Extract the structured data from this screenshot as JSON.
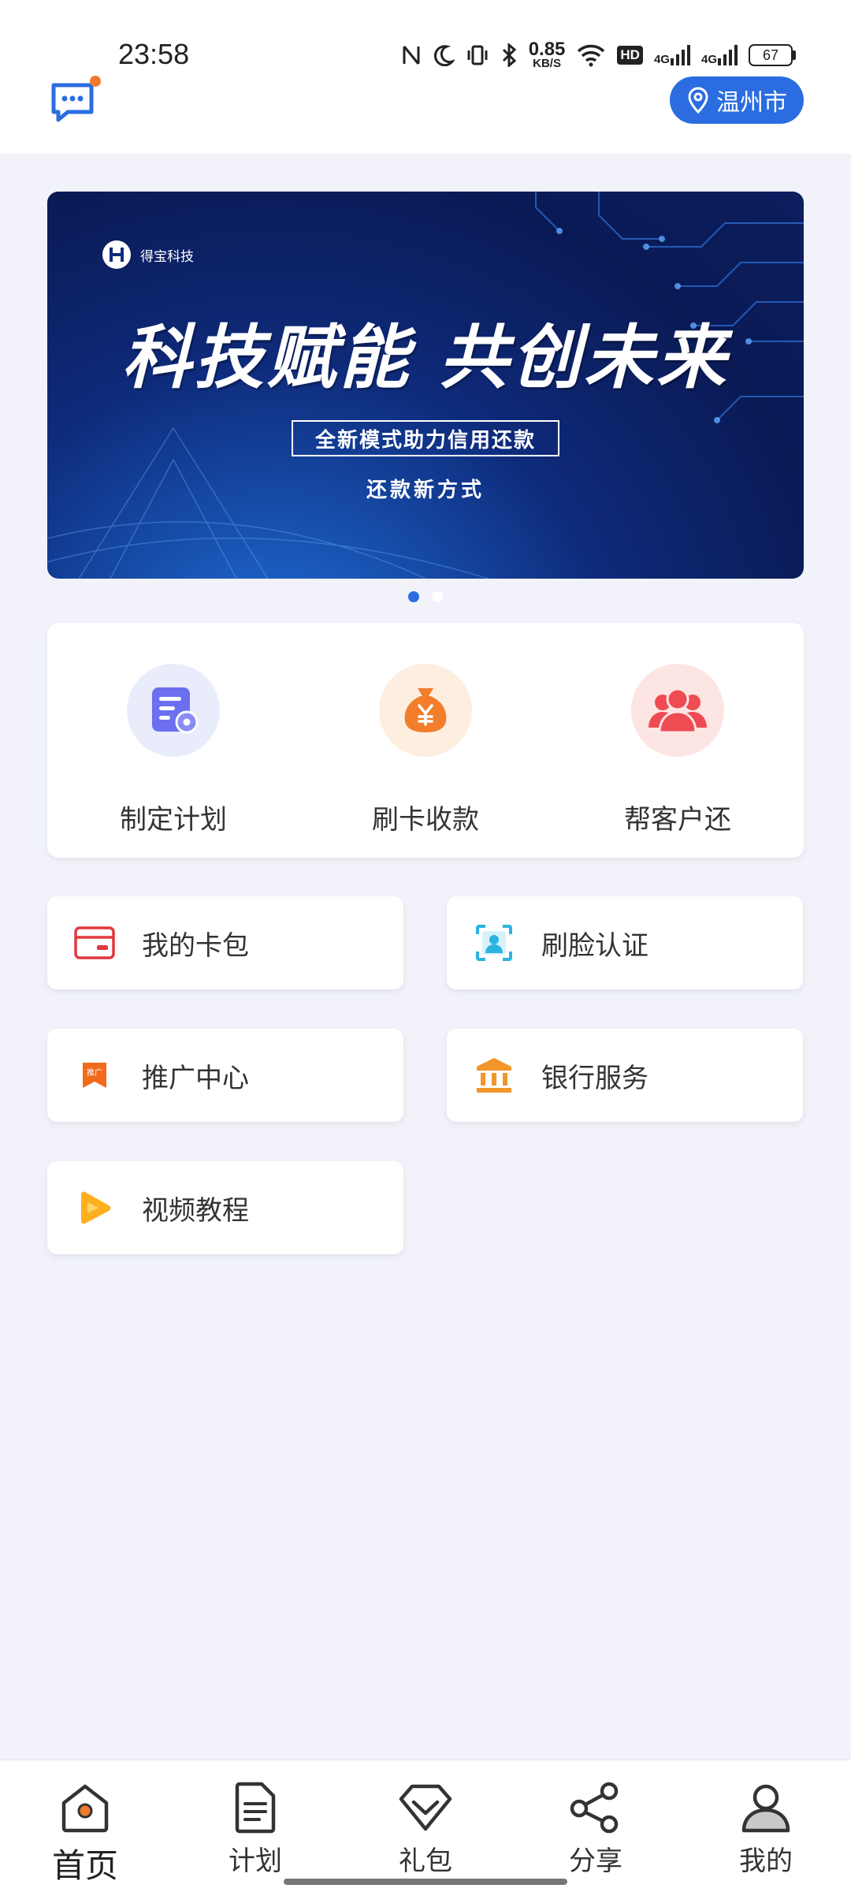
{
  "status_bar": {
    "time": "23:58",
    "net_speed_value": "0.85",
    "net_speed_unit": "KB/S",
    "hd_label": "HD",
    "signal1_label": "4G",
    "signal2_label": "4G",
    "battery": "67"
  },
  "header": {
    "city": "温州市",
    "accent_color": "#2b6de0",
    "message_icon": "chat-bubble-icon"
  },
  "banner": {
    "brand": "得宝科技",
    "headline": "科技赋能 共创未来",
    "subtitle": "全新模式助力信用还款",
    "tagline": "还款新方式",
    "slide_count": 2,
    "active_slide": 1
  },
  "quick_actions": [
    {
      "label": "制定计划",
      "icon": "plan-icon",
      "bg": "#e9ecfb"
    },
    {
      "label": "刷卡收款",
      "icon": "money-bag-icon",
      "bg": "#fdeee0"
    },
    {
      "label": "帮客户还",
      "icon": "users-icon",
      "bg": "#fde5e3"
    }
  ],
  "services": [
    {
      "label": "我的卡包",
      "icon": "card-wallet-icon"
    },
    {
      "label": "刷脸认证",
      "icon": "face-id-icon"
    },
    {
      "label": "推广中心",
      "icon": "promo-flag-icon",
      "icon_text": "推广"
    },
    {
      "label": "银行服务",
      "icon": "bank-icon"
    },
    {
      "label": "视频教程",
      "icon": "video-play-icon"
    }
  ],
  "bottom_nav": [
    {
      "label": "首页",
      "icon": "home-icon",
      "active": true
    },
    {
      "label": "计划",
      "icon": "document-icon",
      "active": false
    },
    {
      "label": "礼包",
      "icon": "gift-diamond-icon",
      "active": false
    },
    {
      "label": "分享",
      "icon": "share-icon",
      "active": false
    },
    {
      "label": "我的",
      "icon": "profile-icon",
      "active": false
    }
  ]
}
